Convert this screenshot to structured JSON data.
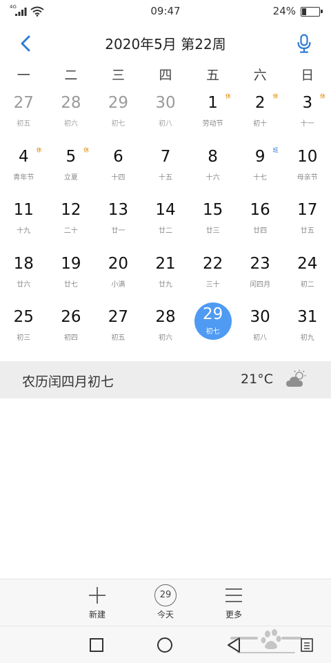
{
  "status_bar": {
    "network": "4G",
    "time": "09:47",
    "battery": "24%",
    "battery_fraction": 0.24
  },
  "header": {
    "title": "2020年5月  第22周",
    "back_icon": "chevron-left-icon",
    "mic_icon": "microphone-icon"
  },
  "weekdays": [
    "一",
    "二",
    "三",
    "四",
    "五",
    "六",
    "日"
  ],
  "weeks": [
    [
      {
        "day": "27",
        "sub": "初五",
        "other": true
      },
      {
        "day": "28",
        "sub": "初六",
        "other": true
      },
      {
        "day": "29",
        "sub": "初七",
        "other": true
      },
      {
        "day": "30",
        "sub": "初八",
        "other": true
      },
      {
        "day": "1",
        "sub": "劳动节",
        "badge": "休",
        "badge_type": "rest"
      },
      {
        "day": "2",
        "sub": "初十",
        "badge": "休",
        "badge_type": "rest"
      },
      {
        "day": "3",
        "sub": "十一",
        "badge": "休",
        "badge_type": "rest"
      }
    ],
    [
      {
        "day": "4",
        "sub": "青年节",
        "badge": "休",
        "badge_type": "rest"
      },
      {
        "day": "5",
        "sub": "立夏",
        "badge": "休",
        "badge_type": "rest"
      },
      {
        "day": "6",
        "sub": "十四"
      },
      {
        "day": "7",
        "sub": "十五"
      },
      {
        "day": "8",
        "sub": "十六"
      },
      {
        "day": "9",
        "sub": "十七",
        "badge": "班",
        "badge_type": "work"
      },
      {
        "day": "10",
        "sub": "母亲节"
      }
    ],
    [
      {
        "day": "11",
        "sub": "十九"
      },
      {
        "day": "12",
        "sub": "二十"
      },
      {
        "day": "13",
        "sub": "廿一"
      },
      {
        "day": "14",
        "sub": "廿二"
      },
      {
        "day": "15",
        "sub": "廿三"
      },
      {
        "day": "16",
        "sub": "廿四"
      },
      {
        "day": "17",
        "sub": "廿五"
      }
    ],
    [
      {
        "day": "18",
        "sub": "廿六"
      },
      {
        "day": "19",
        "sub": "廿七"
      },
      {
        "day": "20",
        "sub": "小满"
      },
      {
        "day": "21",
        "sub": "廿九"
      },
      {
        "day": "22",
        "sub": "三十"
      },
      {
        "day": "23",
        "sub": "闰四月"
      },
      {
        "day": "24",
        "sub": "初二"
      }
    ],
    [
      {
        "day": "25",
        "sub": "初三"
      },
      {
        "day": "26",
        "sub": "初四"
      },
      {
        "day": "27",
        "sub": "初五"
      },
      {
        "day": "28",
        "sub": "初六"
      },
      {
        "day": "29",
        "sub": "初七",
        "selected": true
      },
      {
        "day": "30",
        "sub": "初八"
      },
      {
        "day": "31",
        "sub": "初九"
      }
    ]
  ],
  "info": {
    "lunar_date": "农历闰四月初七",
    "temperature": "21°C",
    "weather_icon": "partly-cloudy-icon"
  },
  "toolbar": {
    "new_label": "新建",
    "today_label": "今天",
    "today_number": "29",
    "more_label": "更多"
  },
  "colors": {
    "accent": "#2f7bd8",
    "selected": "#4f9af3",
    "rest_badge": "#e08a00",
    "info_bar": "#ededed"
  },
  "watermark": "Baidu经验"
}
